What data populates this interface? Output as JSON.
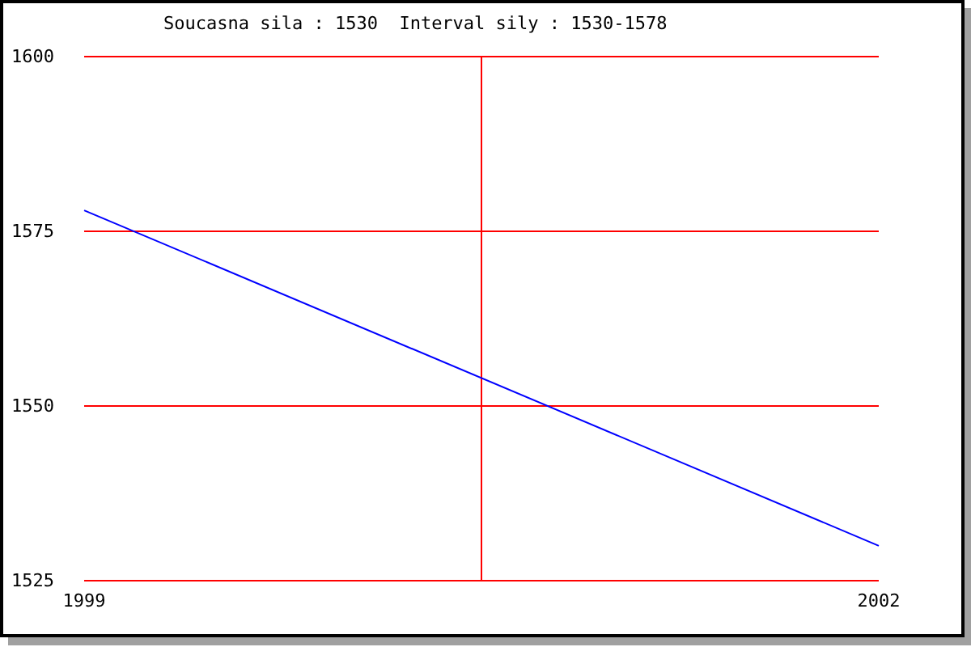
{
  "chart_data": {
    "type": "line",
    "title": "Soucasna sila : 1530  Interval sily : 1530-1578",
    "x": [
      1999,
      2002
    ],
    "series": [
      {
        "color": "#0000ff",
        "values": [
          1578,
          1530
        ]
      }
    ],
    "xlim": [
      1999,
      2002
    ],
    "ylim": [
      1525,
      1600
    ],
    "xticks": [
      1999,
      2002
    ],
    "yticks": [
      1525,
      1550,
      1575,
      1600
    ]
  }
}
